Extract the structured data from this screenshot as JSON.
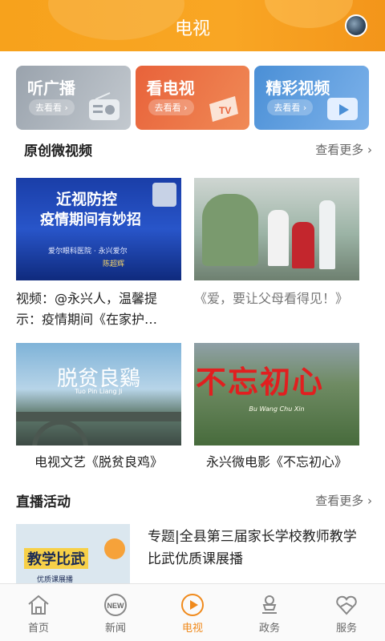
{
  "header": {
    "title": "电视"
  },
  "quick_cards": [
    {
      "label": "听广播",
      "go": "去看看 ›",
      "icon": "radio-icon"
    },
    {
      "label": "看电视",
      "go": "去看看 ›",
      "icon": "tv-icon"
    },
    {
      "label": "精彩视频",
      "go": "去看看 ›",
      "icon": "play-icon"
    }
  ],
  "original_videos": {
    "title": "原创微视频",
    "more": "查看更多 ›",
    "items": [
      {
        "title": "视频：@永兴人，温馨提示：疫情期间《在家护…",
        "thumb_lines": [
          "近视防控",
          "疫情期间有妙招",
          "爱尔眼科医院 · 永兴爱尔",
          "陈超辉"
        ]
      },
      {
        "title": "《爱，要让父母看得见！》"
      },
      {
        "title": "电视文艺《脱贫良鸡》",
        "thumb_lines": [
          "脱贫良鷄",
          "Tuo Pin Liang Ji"
        ]
      },
      {
        "title": "永兴微电影《不忘初心》",
        "thumb_lines": [
          "不忘初心",
          "Bu Wang Chu Xin"
        ]
      }
    ]
  },
  "live": {
    "title": "直播活动",
    "more": "查看更多 ›",
    "items": [
      {
        "title": "专题|全县第三届家长学校教师教学比武优质课展播",
        "thumb_lines": [
          "教学比武",
          "优质课展播"
        ]
      }
    ]
  },
  "bottom_nav": [
    {
      "label": "首页",
      "icon": "home-icon",
      "active": false
    },
    {
      "label": "新闻",
      "icon": "news-icon",
      "active": false
    },
    {
      "label": "电视",
      "icon": "tv-play-icon",
      "active": true
    },
    {
      "label": "政务",
      "icon": "government-icon",
      "active": false
    },
    {
      "label": "服务",
      "icon": "service-icon",
      "active": false
    }
  ],
  "colors": {
    "accent": "#f7a21c",
    "active_nav": "#f08a1c"
  }
}
